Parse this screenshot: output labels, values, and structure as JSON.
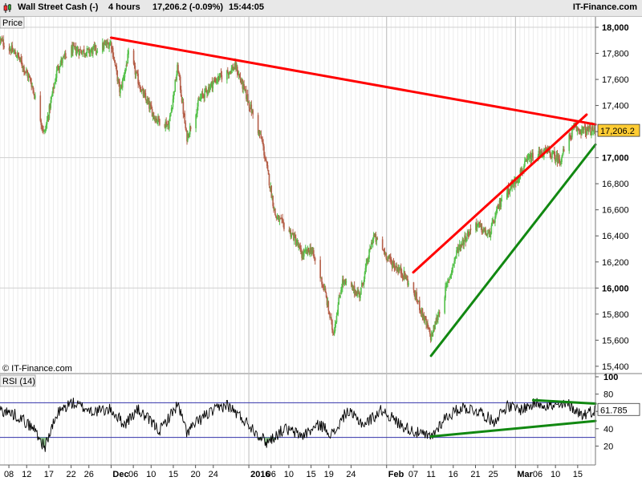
{
  "header": {
    "instrument": "Wall Street Cash (-)",
    "timeframe": "4 hours",
    "price_change": "17,206.2 (-0.09%)",
    "time": "15:44:05",
    "brand": "IT-Finance.com"
  },
  "price_panel": {
    "label": "Price",
    "watermark": "© IT-Finance.com",
    "current_price_label": "17,206.2"
  },
  "rsi_panel": {
    "label": "RSI (14)",
    "current_value_label": "61.785"
  },
  "colors": {
    "up_candle": "#55c14b",
    "down_candle": "#b5604a",
    "resistance": "#ff0000",
    "support": "#118811",
    "rsi_line": "#000000",
    "rsi_levels": "#3333aa",
    "price_tag": "#ffcc33"
  },
  "chart_data": [
    {
      "type": "candlestick",
      "title": "Wall Street Cash (-)",
      "ylim": [
        15350,
        18080
      ],
      "y_ticks": [
        15400,
        15600,
        15800,
        16000,
        16200,
        16400,
        16600,
        16800,
        17000,
        17200,
        17400,
        17600,
        17800,
        18000
      ],
      "y_tick_labels": [
        "15,400",
        "15,600",
        "15,800",
        "16,000",
        "16,200",
        "16,400",
        "16,600",
        "16,800",
        "17,000",
        "17,200",
        "17,400",
        "17,600",
        "17,800",
        "18,000"
      ],
      "bold_ticks": [
        16000,
        17000,
        18000
      ],
      "x_ticks": [
        {
          "date": "2015-11-08",
          "label": "08"
        },
        {
          "date": "2015-11-12",
          "label": "12"
        },
        {
          "date": "2015-11-17",
          "label": "17"
        },
        {
          "date": "2015-11-22",
          "label": "22"
        },
        {
          "date": "2015-11-26",
          "label": "26"
        },
        {
          "date": "2015-12-01",
          "label": "Dec",
          "major": true
        },
        {
          "date": "2015-12-06",
          "label": "06"
        },
        {
          "date": "2015-12-10",
          "label": "10"
        },
        {
          "date": "2015-12-15",
          "label": "15"
        },
        {
          "date": "2015-12-20",
          "label": "20"
        },
        {
          "date": "2015-12-24",
          "label": "24"
        },
        {
          "date": "2016-01-01",
          "label": "2016",
          "major": true
        },
        {
          "date": "2016-01-06",
          "label": "06"
        },
        {
          "date": "2016-01-10",
          "label": "10"
        },
        {
          "date": "2016-01-15",
          "label": "15"
        },
        {
          "date": "2016-01-19",
          "label": "19"
        },
        {
          "date": "2016-01-24",
          "label": "24"
        },
        {
          "date": "2016-02-01",
          "label": "Feb",
          "major": true
        },
        {
          "date": "2016-02-07",
          "label": "07"
        },
        {
          "date": "2016-02-11",
          "label": "11"
        },
        {
          "date": "2016-02-16",
          "label": "16"
        },
        {
          "date": "2016-02-21",
          "label": "21"
        },
        {
          "date": "2016-02-25",
          "label": "25"
        },
        {
          "date": "2016-03-01",
          "label": "Mar",
          "major": true
        },
        {
          "date": "2016-03-06",
          "label": "06"
        },
        {
          "date": "2016-03-10",
          "label": "10"
        },
        {
          "date": "2016-03-15",
          "label": "15"
        }
      ],
      "x_range": [
        "2015-11-06",
        "2016-03-19"
      ],
      "last_price": 17206.2,
      "anchors": [
        [
          "2015-11-06",
          17900
        ],
        [
          "2015-11-10",
          17780
        ],
        [
          "2015-11-13",
          17580
        ],
        [
          "2015-11-16",
          17180
        ],
        [
          "2015-11-19",
          17700
        ],
        [
          "2015-11-22",
          17830
        ],
        [
          "2015-11-26",
          17810
        ],
        [
          "2015-12-01",
          17880
        ],
        [
          "2015-12-03",
          17500
        ],
        [
          "2015-12-05",
          17800
        ],
        [
          "2015-12-08",
          17500
        ],
        [
          "2015-12-11",
          17300
        ],
        [
          "2015-12-14",
          17250
        ],
        [
          "2015-12-16",
          17700
        ],
        [
          "2015-12-18",
          17150
        ],
        [
          "2015-12-21",
          17450
        ],
        [
          "2015-12-24",
          17580
        ],
        [
          "2015-12-29",
          17700
        ],
        [
          "2016-01-01",
          17420
        ],
        [
          "2016-01-04",
          17120
        ],
        [
          "2016-01-07",
          16550
        ],
        [
          "2016-01-11",
          16400
        ],
        [
          "2016-01-13",
          16250
        ],
        [
          "2016-01-15",
          16300
        ],
        [
          "2016-01-18",
          15990
        ],
        [
          "2016-01-20",
          15650
        ],
        [
          "2016-01-22",
          16050
        ],
        [
          "2016-01-26",
          15950
        ],
        [
          "2016-01-29",
          16400
        ],
        [
          "2016-02-02",
          16200
        ],
        [
          "2016-02-05",
          16100
        ],
        [
          "2016-02-08",
          15900
        ],
        [
          "2016-02-11",
          15620
        ],
        [
          "2016-02-14",
          15950
        ],
        [
          "2016-02-17",
          16300
        ],
        [
          "2016-02-21",
          16500
        ],
        [
          "2016-02-24",
          16400
        ],
        [
          "2016-02-27",
          16700
        ],
        [
          "2016-03-01",
          16820
        ],
        [
          "2016-03-04",
          16990
        ],
        [
          "2016-03-08",
          17050
        ],
        [
          "2016-03-11",
          16980
        ],
        [
          "2016-03-14",
          17220
        ],
        [
          "2016-03-17",
          17206
        ]
      ],
      "trendlines": [
        {
          "name": "resistance",
          "color": "#ff0000",
          "from": [
            "2015-12-01",
            17920
          ],
          "to": [
            "2016-03-19",
            17255
          ]
        },
        {
          "name": "channel-top",
          "color": "#ff0000",
          "from": [
            "2016-02-07",
            16120
          ],
          "to": [
            "2016-03-17",
            17330
          ]
        },
        {
          "name": "channel-bottom",
          "color": "#118811",
          "from": [
            "2016-02-11",
            15480
          ],
          "to": [
            "2016-03-19",
            17100
          ]
        }
      ]
    },
    {
      "type": "line",
      "title": "RSI (14)",
      "ylim": [
        0,
        100
      ],
      "y_ticks": [
        20,
        40,
        60,
        80,
        100
      ],
      "y_tick_labels": [
        "20",
        "40",
        "60",
        "80",
        "100"
      ],
      "levels": [
        30,
        70
      ],
      "last_value": 61.785,
      "anchors": [
        [
          "2015-11-06",
          62
        ],
        [
          "2015-11-10",
          55
        ],
        [
          "2015-11-14",
          38
        ],
        [
          "2015-11-16",
          18
        ],
        [
          "2015-11-19",
          58
        ],
        [
          "2015-11-22",
          70
        ],
        [
          "2015-11-27",
          60
        ],
        [
          "2015-12-01",
          62
        ],
        [
          "2015-12-04",
          45
        ],
        [
          "2015-12-07",
          62
        ],
        [
          "2015-12-12",
          38
        ],
        [
          "2015-12-16",
          68
        ],
        [
          "2015-12-18",
          36
        ],
        [
          "2015-12-22",
          55
        ],
        [
          "2015-12-27",
          68
        ],
        [
          "2016-01-01",
          45
        ],
        [
          "2016-01-05",
          24
        ],
        [
          "2016-01-09",
          40
        ],
        [
          "2016-01-13",
          32
        ],
        [
          "2016-01-17",
          45
        ],
        [
          "2016-01-20",
          33
        ],
        [
          "2016-01-23",
          60
        ],
        [
          "2016-01-27",
          45
        ],
        [
          "2016-01-31",
          62
        ],
        [
          "2016-02-04",
          45
        ],
        [
          "2016-02-08",
          35
        ],
        [
          "2016-02-11",
          30
        ],
        [
          "2016-02-14",
          52
        ],
        [
          "2016-02-18",
          65
        ],
        [
          "2016-02-22",
          60
        ],
        [
          "2016-02-25",
          48
        ],
        [
          "2016-02-28",
          66
        ],
        [
          "2016-03-02",
          62
        ],
        [
          "2016-03-06",
          70
        ],
        [
          "2016-03-10",
          65
        ],
        [
          "2016-03-13",
          68
        ],
        [
          "2016-03-16",
          56
        ],
        [
          "2016-03-19",
          62
        ]
      ],
      "trendlines": [
        {
          "name": "rsi-resistance",
          "color": "#118811",
          "from": [
            "2016-03-05",
            73
          ],
          "to": [
            "2016-03-19",
            69
          ]
        },
        {
          "name": "rsi-support",
          "color": "#118811",
          "from": [
            "2016-02-11",
            31
          ],
          "to": [
            "2016-03-19",
            49
          ]
        }
      ]
    }
  ]
}
